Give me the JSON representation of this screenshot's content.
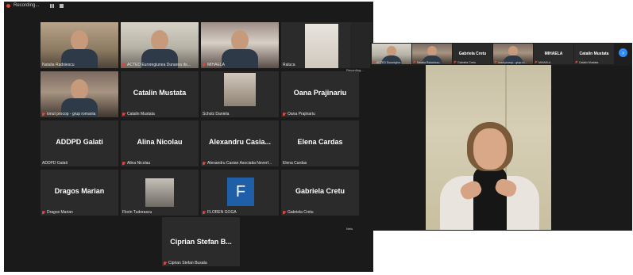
{
  "recording": {
    "label": "Recording..."
  },
  "grid_tiles": [
    {
      "type": "video",
      "variant": "v1",
      "label": "Natalia Radoiescu",
      "muted": false,
      "active": true
    },
    {
      "type": "video",
      "variant": "v2",
      "label": "ACTED Euroregiunea Dunarea de...",
      "muted": true,
      "active": false
    },
    {
      "type": "video",
      "variant": "v3",
      "label": "MIHAELA",
      "muted": true,
      "active": false
    },
    {
      "type": "thumb",
      "thumb": "raluca",
      "label": "Raluca",
      "muted": false,
      "active": false
    },
    {
      "type": "video",
      "variant": "v4",
      "label": "ionut procop - grup romania",
      "muted": true,
      "active": false
    },
    {
      "type": "name",
      "name": "Catalin Mustata",
      "label": "Catalin Mustata",
      "muted": true
    },
    {
      "type": "thumb",
      "thumb": "scholz",
      "label": "Scholz Daniela",
      "muted": false
    },
    {
      "type": "name",
      "name": "Oana Prajinariu",
      "label": "Oana Prajinariu",
      "muted": true
    },
    {
      "type": "name",
      "name": "ADDPD Galati",
      "label": "ADDPD Galati",
      "muted": false
    },
    {
      "type": "name",
      "name": "Alina Nicolau",
      "label": "Alina Nicolau",
      "muted": true
    },
    {
      "type": "name",
      "name": "Alexandru  Casia...",
      "label": "Alexandru Casian Asociatia Neverf...",
      "muted": true
    },
    {
      "type": "name",
      "name": "Elena Cardas",
      "label": "Elena Cardas",
      "muted": false
    },
    {
      "type": "name",
      "name": "Dragos Marian",
      "label": "Dragos Marian",
      "muted": true
    },
    {
      "type": "thumb",
      "thumb": "florin",
      "label": "Florin Tudorascu",
      "muted": false
    },
    {
      "type": "letter",
      "letter": "F",
      "label": "FLOREN GOGA",
      "muted": true
    },
    {
      "type": "name",
      "name": "Gabriela Cretu",
      "label": "Gabriela Cretu",
      "muted": true
    }
  ],
  "last_tile": {
    "name": "Ciprian  Stefan  B...",
    "label": "Ciprian Stefan Busata"
  },
  "overflow_label": "Recording...",
  "overflow_label2": "Nelu",
  "strip": [
    {
      "type": "video",
      "variant": "v2",
      "label": "ACTED Euroregiun..."
    },
    {
      "type": "video",
      "variant": "v4",
      "label": "Natalia Radoiescu"
    },
    {
      "type": "name",
      "name": "Gabriela Cretu",
      "label": "Gabriela Cretu"
    },
    {
      "type": "video",
      "variant": "v4",
      "label": "ionut procop - grup ro..."
    },
    {
      "type": "name",
      "name": "MIHAELA",
      "label": "MIHAELA"
    },
    {
      "type": "name",
      "name": "Catalin Mustata",
      "label": "Catalin Mustata"
    }
  ],
  "next_icon": "›"
}
